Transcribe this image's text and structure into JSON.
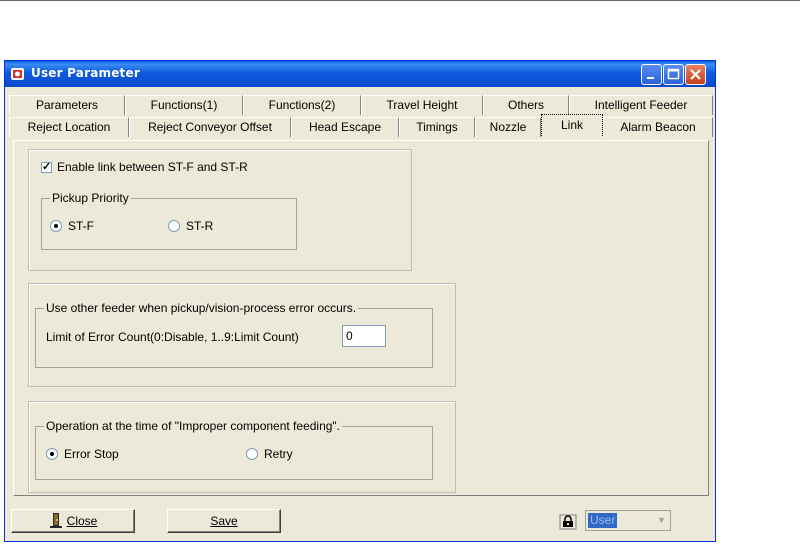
{
  "window": {
    "title": "User Parameter"
  },
  "tabs": {
    "row1": [
      "Parameters",
      "Functions(1)",
      "Functions(2)",
      "Travel Height",
      "Others",
      "Intelligent Feeder"
    ],
    "row2": [
      "Reject Location",
      "Reject Conveyor Offset",
      "Head Escape",
      "Timings",
      "Nozzle",
      "Link",
      "Alarm Beacon"
    ],
    "active": "Link"
  },
  "link_section": {
    "enable_label": "Enable link between ST-F and ST-R",
    "enable_checked": true,
    "pickup_group_title": "Pickup Priority",
    "options": [
      "ST-F",
      "ST-R"
    ],
    "selected": "ST-F"
  },
  "error_section": {
    "group_title": "Use other feeder when pickup/vision-process error occurs.",
    "limit_label": "Limit of Error Count(0:Disable, 1..9:Limit Count)",
    "limit_value": "0"
  },
  "operation_section": {
    "group_title": "Operation at the time of \"Improper component feeding\".",
    "options": [
      "Error Stop",
      "Retry"
    ],
    "selected": "Error Stop"
  },
  "footer": {
    "close_label": "Close",
    "save_label": "Save",
    "user_combo_value": "User"
  }
}
